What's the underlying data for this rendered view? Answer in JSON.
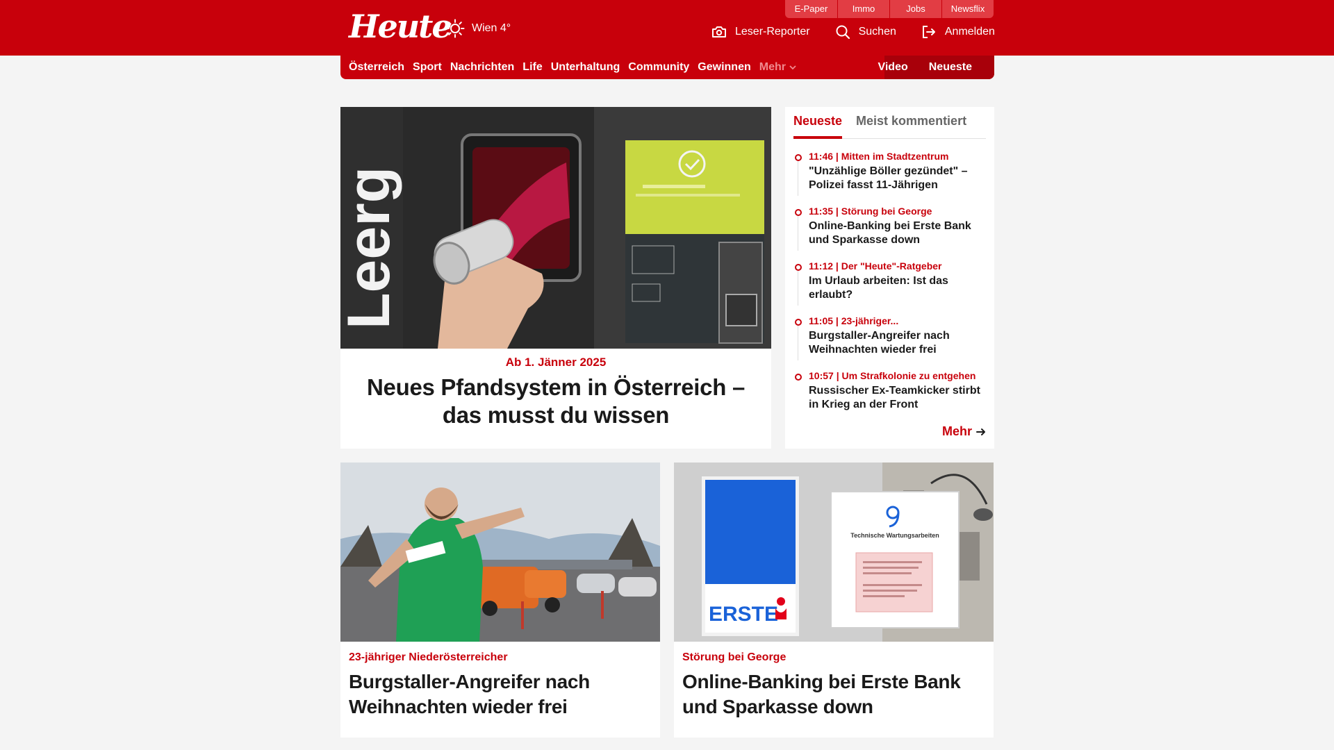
{
  "brand": {
    "logo_text": "Heute",
    "weather": "Wien 4°",
    "accent_color": "#c8000b"
  },
  "topbar": [
    "E-Paper",
    "Immo",
    "Jobs",
    "Newsflix"
  ],
  "actions": {
    "leser_reporter": "Leser-Reporter",
    "search": "Suchen",
    "login": "Anmelden"
  },
  "nav": {
    "items": [
      "Österreich",
      "Sport",
      "Nachrichten",
      "Life",
      "Unterhaltung",
      "Community",
      "Gewinnen"
    ],
    "more": "Mehr",
    "right": [
      "Video",
      "Neueste"
    ]
  },
  "hero": {
    "image": "leergut-pfandautomat",
    "kicker": "Ab 1. Jänner 2025",
    "title": "Neues Pfandsystem in Österreich – das musst du wissen"
  },
  "sidebar": {
    "tabs": [
      "Neueste",
      "Meist kommentiert"
    ],
    "items": [
      {
        "meta": "11:46 | Mitten im Stadtzentrum",
        "headline": "\"Unzählige Böller gezündet\" – Polizei fasst 11-Jährigen"
      },
      {
        "meta": "11:35 | Störung bei George",
        "headline": "Online-Banking bei Erste Bank und Sparkasse down"
      },
      {
        "meta": "11:12 | Der \"Heute\"-Ratgeber",
        "headline": "Im Urlaub arbeiten: Ist das erlaubt?"
      },
      {
        "meta": "11:05 | 23-jähriger...",
        "headline": "Burgstaller-Angreifer nach Weihnachten wieder frei"
      },
      {
        "meta": "10:57 | Um Strafkolonie zu entgehen",
        "headline": "Russischer Ex-Teamkicker stirbt in Krieg an der Front"
      }
    ],
    "more": "Mehr"
  },
  "cards": [
    {
      "image": "footballer-parking-lot",
      "kicker": "23-jähriger Niederösterreicher",
      "title": "Burgstaller-Angreifer nach Weihnachten wieder frei"
    },
    {
      "image": "erste-bank-george-maintenance",
      "kicker": "Störung bei George",
      "title": "Online-Banking bei Erste Bank und Sparkasse down",
      "image_sign_text": "ERSTE",
      "image_screen_title": "Technische Wartungsarbeiten"
    }
  ]
}
